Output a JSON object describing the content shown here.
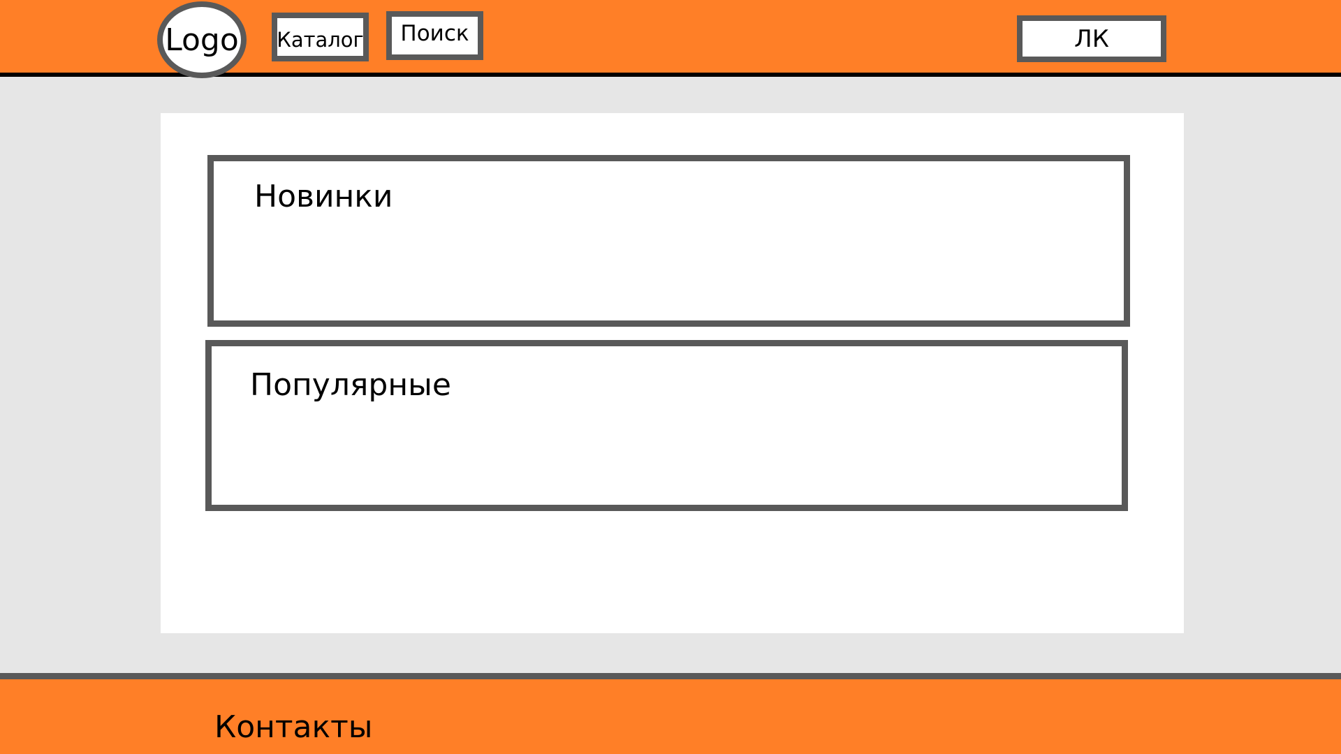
{
  "header": {
    "logo_text": "Logo",
    "catalog_label": "Каталог",
    "search_label": "Поиск",
    "account_label": "ЛК"
  },
  "main": {
    "sections": [
      {
        "title": "Новинки"
      },
      {
        "title": "Популярные"
      }
    ]
  },
  "footer": {
    "contacts_label": "Контакты"
  },
  "colors": {
    "header_footer_bg": "#ff7f27",
    "page_bg": "#e6e6e6",
    "border": "#595959",
    "content_bg": "#ffffff"
  }
}
